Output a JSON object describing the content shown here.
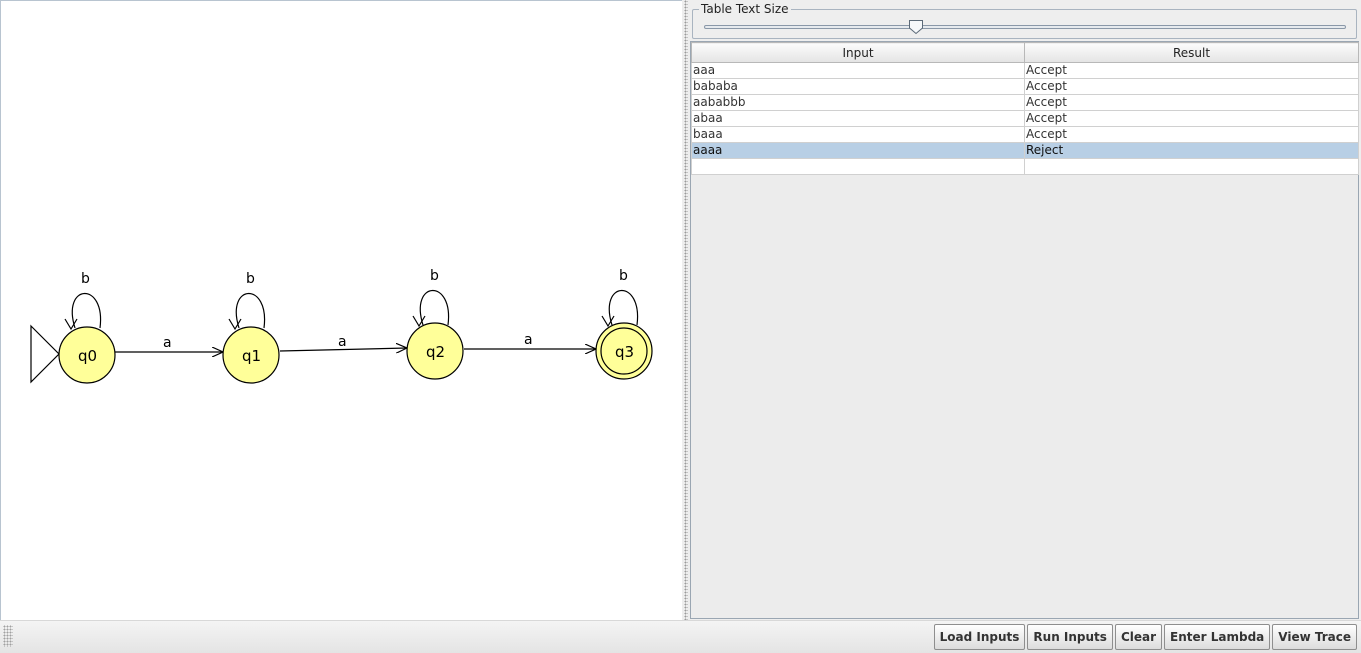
{
  "automaton": {
    "states": [
      {
        "id": "q0",
        "label": "q0",
        "initial": true,
        "final": false
      },
      {
        "id": "q1",
        "label": "q1",
        "initial": false,
        "final": false
      },
      {
        "id": "q2",
        "label": "q2",
        "initial": false,
        "final": false
      },
      {
        "id": "q3",
        "label": "q3",
        "initial": false,
        "final": true
      }
    ],
    "transitions": [
      {
        "from": "q0",
        "to": "q0",
        "label": "b"
      },
      {
        "from": "q1",
        "to": "q1",
        "label": "b"
      },
      {
        "from": "q2",
        "to": "q2",
        "label": "b"
      },
      {
        "from": "q3",
        "to": "q3",
        "label": "b"
      },
      {
        "from": "q0",
        "to": "q1",
        "label": "a"
      },
      {
        "from": "q1",
        "to": "q2",
        "label": "a"
      },
      {
        "from": "q2",
        "to": "q3",
        "label": "a"
      }
    ],
    "colors": {
      "state_fill": "#ffff99",
      "stroke": "#000000",
      "background": "#ffffff"
    }
  },
  "size_control": {
    "title": "Table Text Size",
    "slider_value_fraction": 0.33
  },
  "table": {
    "headers": {
      "input": "Input",
      "result": "Result"
    },
    "rows": [
      {
        "input": "aaa",
        "result": "Accept",
        "selected": false
      },
      {
        "input": "bababa",
        "result": "Accept",
        "selected": false
      },
      {
        "input": "aababbb",
        "result": "Accept",
        "selected": false
      },
      {
        "input": "abaa",
        "result": "Accept",
        "selected": false
      },
      {
        "input": "baaa",
        "result": "Accept",
        "selected": false
      },
      {
        "input": "aaaa",
        "result": "Reject",
        "selected": true
      },
      {
        "input": "",
        "result": "",
        "selected": false
      }
    ],
    "selected_color": "#b8cfe5"
  },
  "buttons": {
    "load_inputs": "Load Inputs",
    "run_inputs": "Run Inputs",
    "clear": "Clear",
    "enter_lambda": "Enter Lambda",
    "view_trace": "View Trace"
  }
}
